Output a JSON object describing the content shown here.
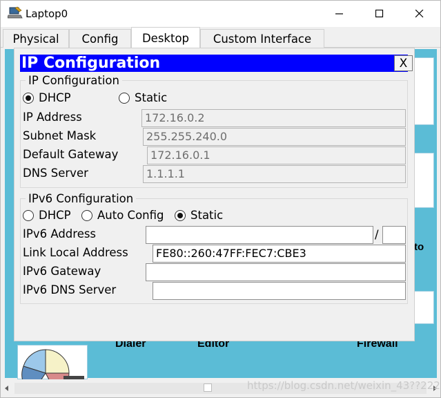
{
  "window": {
    "title": "Laptop0",
    "icon": "laptop-app-icon",
    "controls": [
      "minimize-icon",
      "maximize-icon",
      "close-icon"
    ]
  },
  "tabs": [
    {
      "label": "Physical",
      "active": false
    },
    {
      "label": "Config",
      "active": false
    },
    {
      "label": "Desktop",
      "active": true
    },
    {
      "label": "Custom Interface",
      "active": false
    }
  ],
  "desktop": {
    "background_color": "#5bbcd6",
    "app_labels": {
      "dialer": "Dialer",
      "editor": "Editor",
      "firewall": "Firewall"
    }
  },
  "dialog": {
    "title": "IP Configuration",
    "close_label": "X",
    "title_color": "#0000ff",
    "ipv4": {
      "section_title": "IP Configuration",
      "mode_options": [
        {
          "label": "DHCP",
          "checked": true
        },
        {
          "label": "Static",
          "checked": false
        }
      ],
      "fields": {
        "ip_address": {
          "label": "IP Address",
          "value": "172.16.0.2"
        },
        "subnet_mask": {
          "label": "Subnet Mask",
          "value": "255.255.240.0"
        },
        "default_gateway": {
          "label": "Default Gateway",
          "value": "172.16.0.1"
        },
        "dns_server": {
          "label": "DNS Server",
          "value": "1.1.1.1"
        }
      }
    },
    "ipv6": {
      "section_title": "IPv6 Configuration",
      "mode_options": [
        {
          "label": "DHCP",
          "checked": false
        },
        {
          "label": "Auto Config",
          "checked": false
        },
        {
          "label": "Static",
          "checked": true
        }
      ],
      "fields": {
        "ipv6_address": {
          "label": "IPv6 Address",
          "value": "",
          "prefix_separator": "/",
          "prefix": ""
        },
        "link_local": {
          "label": "Link Local Address",
          "value": "FE80::260:47FF:FEC7:CBE3"
        },
        "ipv6_gateway": {
          "label": "IPv6 Gateway",
          "value": ""
        },
        "ipv6_dns": {
          "label": "IPv6 DNS Server",
          "value": ""
        }
      }
    }
  },
  "watermark": "https://blog.csdn.net/weixin_43??222"
}
